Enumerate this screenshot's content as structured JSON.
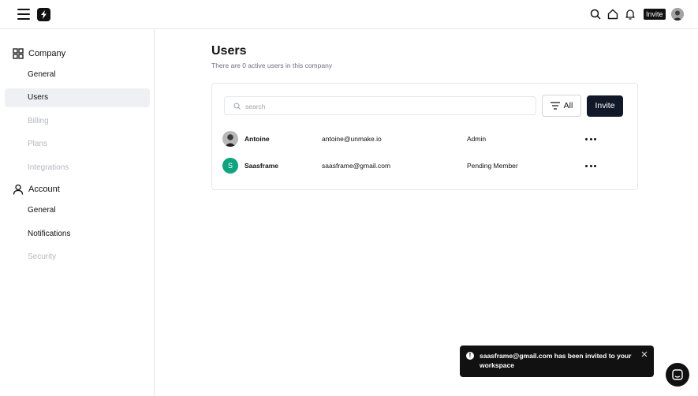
{
  "topbar": {
    "invite_label": "Invite"
  },
  "sidebar": {
    "company": {
      "label": "Company",
      "icon": "grid-icon",
      "items": [
        {
          "label": "General",
          "state": "normal"
        },
        {
          "label": "Users",
          "state": "active"
        },
        {
          "label": "Billing",
          "state": "disabled"
        },
        {
          "label": "Plans",
          "state": "disabled"
        },
        {
          "label": "Integrations",
          "state": "disabled"
        }
      ]
    },
    "account": {
      "label": "Account",
      "icon": "user-icon",
      "items": [
        {
          "label": "General",
          "state": "normal"
        },
        {
          "label": "Notifications",
          "state": "normal"
        },
        {
          "label": "Security",
          "state": "disabled"
        }
      ]
    }
  },
  "main": {
    "title": "Users",
    "subtitle": "There are 0 active users in this company",
    "search_placeholder": "search",
    "filter_label": "All",
    "invite_button": "Invite",
    "users": [
      {
        "name": "Antoine",
        "email": "antoine@unmake.io",
        "role": "Admin",
        "avatar": "photo"
      },
      {
        "name": "Saasframe",
        "email": "saasframe@gmail.com",
        "role": "Pending Member",
        "avatar": "S"
      }
    ]
  },
  "toast": {
    "message": "saasframe@gmail.com has been invited to your workspace"
  },
  "colors": {
    "accent": "#111827",
    "avatar_green": "#10a37f",
    "active_bg": "#eef0f3",
    "disabled_text": "#b4b8bf"
  }
}
